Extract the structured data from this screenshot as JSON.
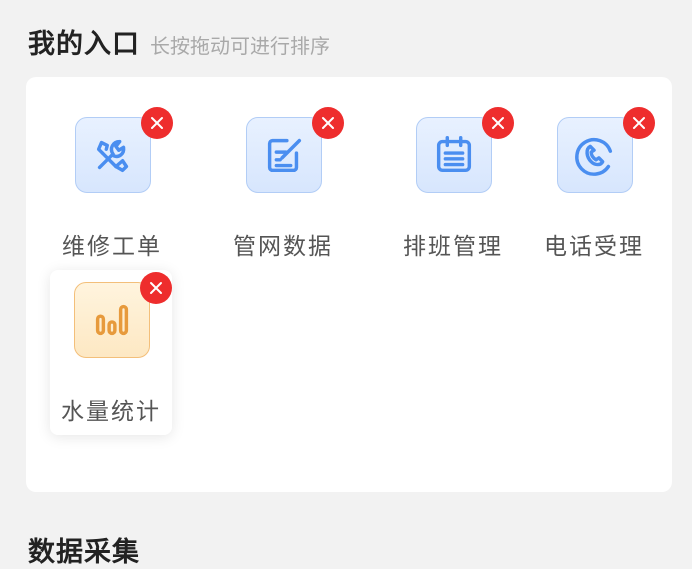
{
  "header": {
    "title": "我的入口",
    "hint": "长按拖动可进行排序"
  },
  "entries": [
    {
      "label": "维修工单",
      "icon": "wrench-screwdriver-icon",
      "theme": "blue"
    },
    {
      "label": "管网数据",
      "icon": "edit-document-icon",
      "theme": "blue"
    },
    {
      "label": "排班管理",
      "icon": "calendar-list-icon",
      "theme": "blue"
    },
    {
      "label": "电话受理",
      "icon": "phone-icon",
      "theme": "blue"
    },
    {
      "label": "水量统计",
      "icon": "bar-chart-icon",
      "theme": "orange"
    }
  ],
  "colors": {
    "accent_blue": "#4a8ef0",
    "accent_orange": "#e79a3c",
    "remove_red": "#ee2d2d"
  },
  "next_section": {
    "title": "数据采集"
  }
}
